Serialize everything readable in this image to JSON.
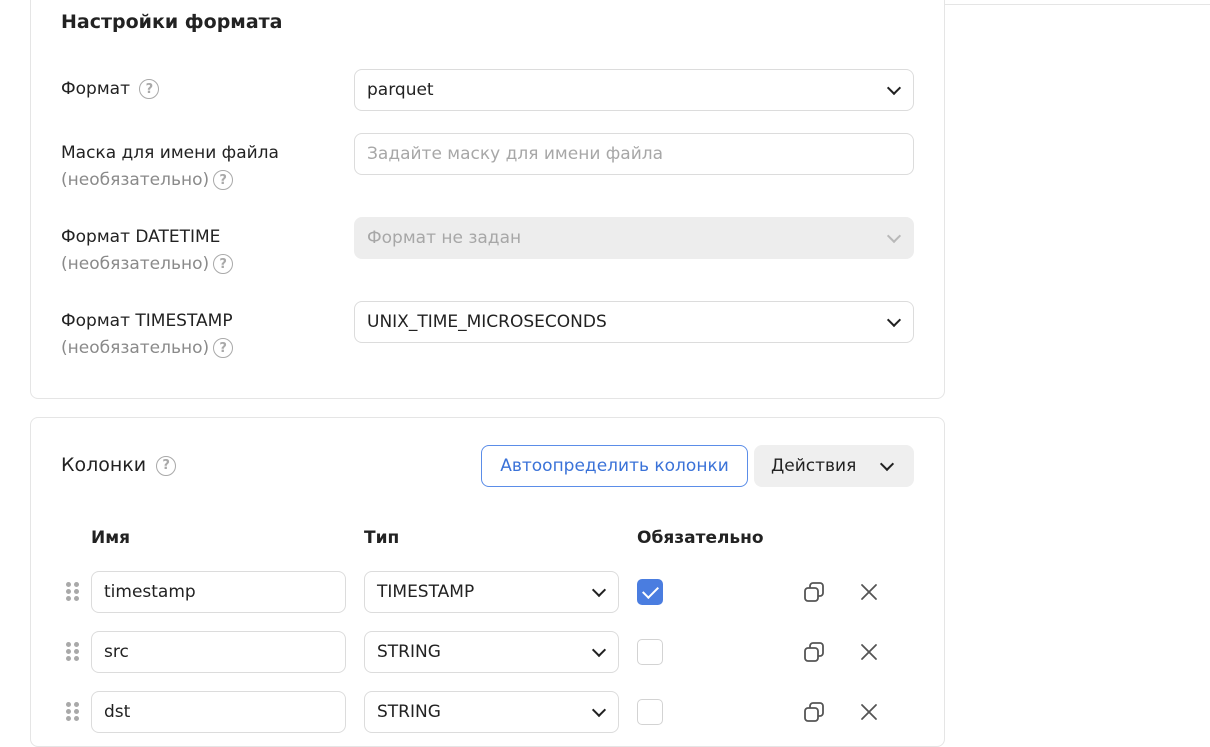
{
  "format_settings": {
    "title": "Настройки формата",
    "format": {
      "label": "Формат",
      "value": "parquet"
    },
    "file_mask": {
      "label": "Маска для имени файла",
      "optional": "(необязательно)",
      "placeholder": "Задайте маску для имени файла"
    },
    "datetime_format": {
      "label": "Формат DATETIME",
      "optional": "(необязательно)",
      "value": "Формат не задан"
    },
    "timestamp_format": {
      "label": "Формат TIMESTAMP",
      "optional": "(необязательно)",
      "value": "UNIX_TIME_MICROSECONDS"
    }
  },
  "columns": {
    "title": "Колонки",
    "autodetect_button": "Автоопределить колонки",
    "actions_button": "Действия",
    "headers": {
      "name": "Имя",
      "type": "Тип",
      "required": "Обязательно"
    },
    "rows": [
      {
        "name": "timestamp",
        "type": "TIMESTAMP",
        "required": true
      },
      {
        "name": "src",
        "type": "STRING",
        "required": false
      },
      {
        "name": "dst",
        "type": "STRING",
        "required": false
      }
    ]
  },
  "icons": {
    "help": "?",
    "copy": "copy-icon",
    "remove": "close-icon",
    "drag": "drag-handle-icon"
  },
  "colors": {
    "accent": "#4a7de0",
    "border": "#dcdcdc",
    "disabled_bg": "#ededed"
  }
}
